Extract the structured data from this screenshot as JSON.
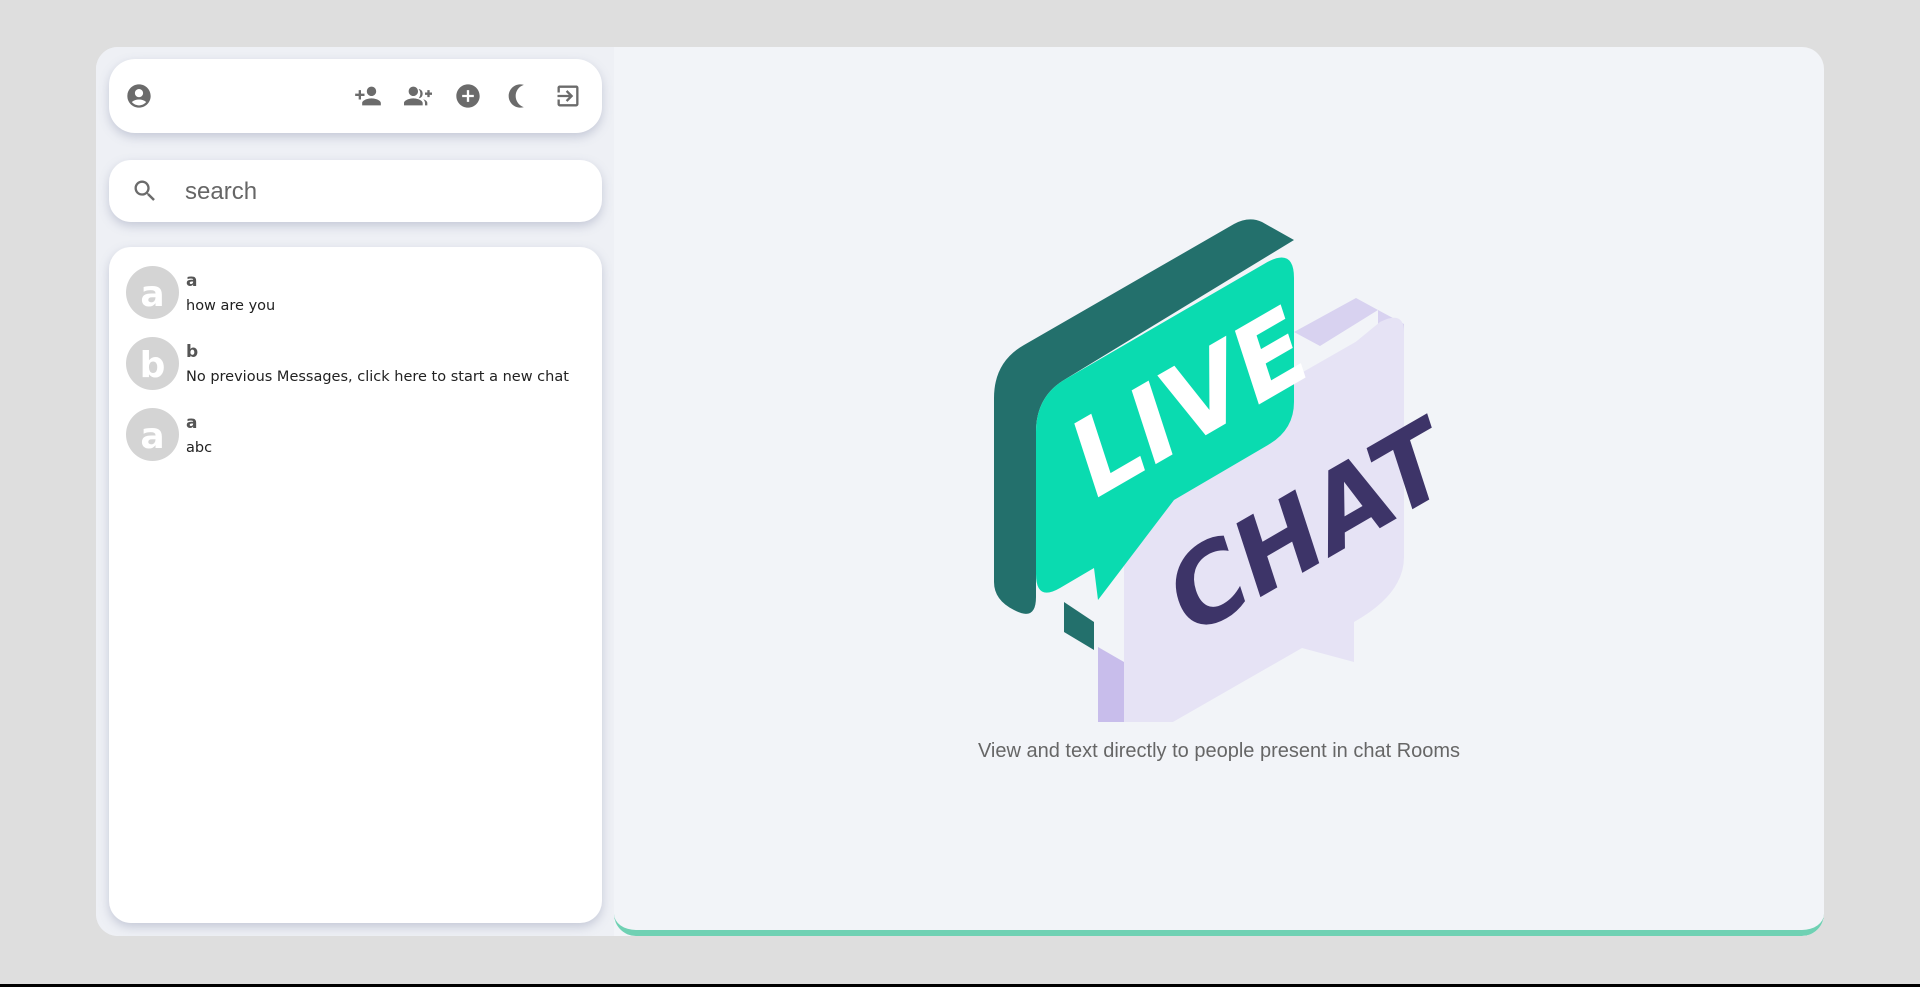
{
  "toolbar": {
    "icons": [
      "account-circle-icon",
      "add-person-icon",
      "add-group-icon",
      "add-circle-icon",
      "dark-mode-icon",
      "logout-icon"
    ]
  },
  "search": {
    "placeholder": "search"
  },
  "chats": [
    {
      "avatar": "a",
      "name": "a",
      "message": "how are you"
    },
    {
      "avatar": "b",
      "name": "b",
      "message": "No previous Messages, click here to start a new chat"
    },
    {
      "avatar": "a",
      "name": "a",
      "message": "abc"
    }
  ],
  "hero": {
    "live_text": "LIVE",
    "chat_text": "CHAT",
    "caption": "View and text directly to people present in chat Rooms"
  },
  "colors": {
    "accent": "#6fd1b3",
    "bubble_green": "#0adbb0",
    "bubble_green_dark": "#23706c",
    "bubble_lilac": "#e6e3f5",
    "chat_text": "#3d3468",
    "icon_gray": "#6b6b6b"
  }
}
